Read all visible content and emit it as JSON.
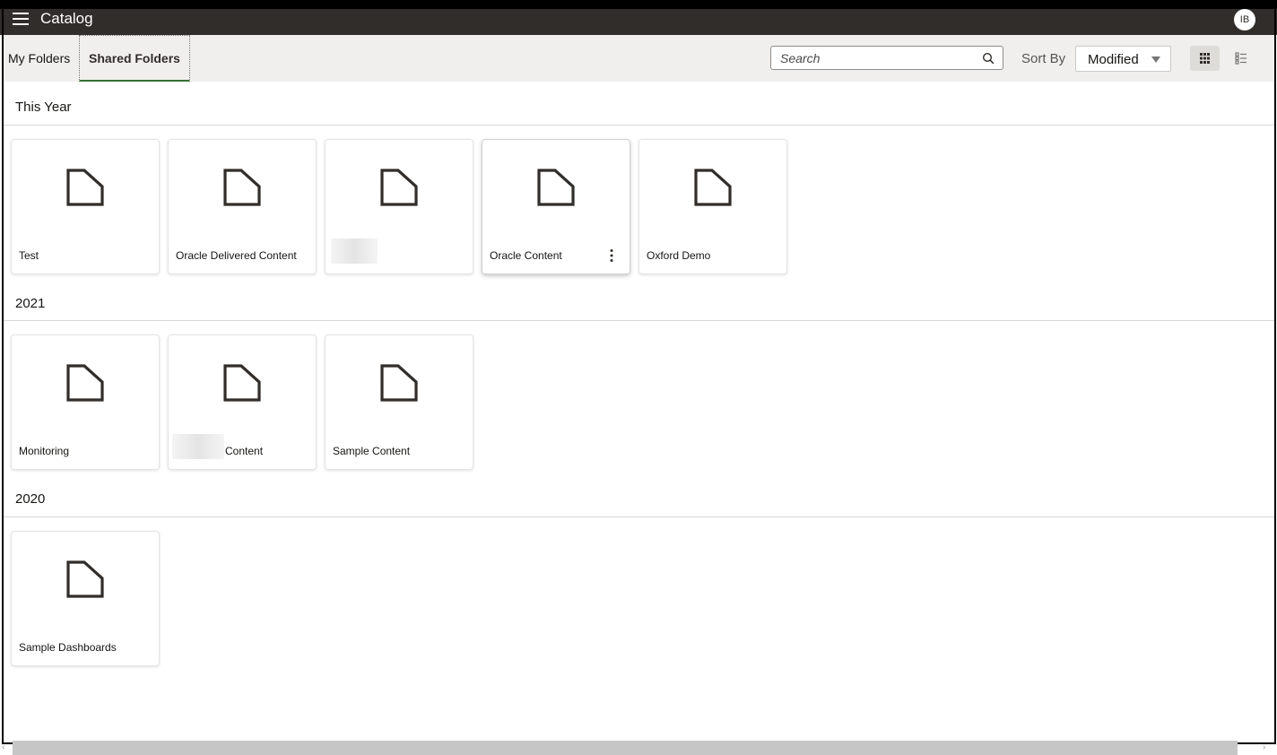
{
  "header": {
    "title": "Catalog",
    "avatar_initials": "IB",
    "background_color": "#312d2a"
  },
  "tabs": [
    {
      "label": "My Folders",
      "selected": false
    },
    {
      "label": "Shared Folders",
      "selected": true
    }
  ],
  "search": {
    "placeholder": "Search",
    "value": ""
  },
  "sort": {
    "label": "Sort By",
    "selected": "Modified"
  },
  "view": {
    "modes": [
      "grid",
      "list"
    ],
    "active": "grid"
  },
  "sections": [
    {
      "title": "This Year",
      "folders": [
        {
          "name": "Test"
        },
        {
          "name": "Oracle Delivered Content"
        },
        {
          "name": ""
        },
        {
          "name": "Oracle Content",
          "has_menu": true
        },
        {
          "name": "Oxford Demo"
        }
      ]
    },
    {
      "title": "2021",
      "folders": [
        {
          "name": "Monitoring"
        },
        {
          "name": "Content"
        },
        {
          "name": "Sample Content"
        }
      ]
    },
    {
      "title": "2020",
      "folders": [
        {
          "name": "Sample Dashboards"
        }
      ]
    }
  ],
  "icons": {
    "menu": "hamburger-icon",
    "search": "search-icon",
    "folder": "folder-icon",
    "more": "more-vertical-icon",
    "grid_view": "grid-view-icon",
    "list_view": "list-view-icon"
  }
}
